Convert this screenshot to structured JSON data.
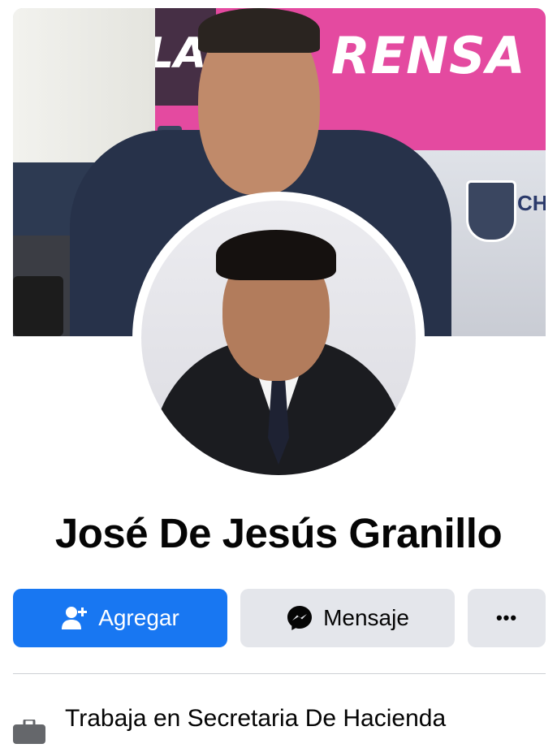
{
  "cover": {
    "banner_text_right": "RENSA",
    "banner_text_left": "LA",
    "logo_text": "CH"
  },
  "profile": {
    "name": "José De Jesús Granillo"
  },
  "actions": {
    "add_label": "Agregar",
    "message_label": "Mensaje",
    "more_label": "•••"
  },
  "about": {
    "work_text": "Trabaja en Secretaria De Hacienda"
  },
  "colors": {
    "primary": "#1877f2",
    "secondary_button": "#e4e6eb",
    "divider": "#ced0d4",
    "banner_pink": "#e44aa0"
  },
  "icons": {
    "add": "add-friend-icon",
    "message": "messenger-icon",
    "work": "briefcase-icon"
  }
}
